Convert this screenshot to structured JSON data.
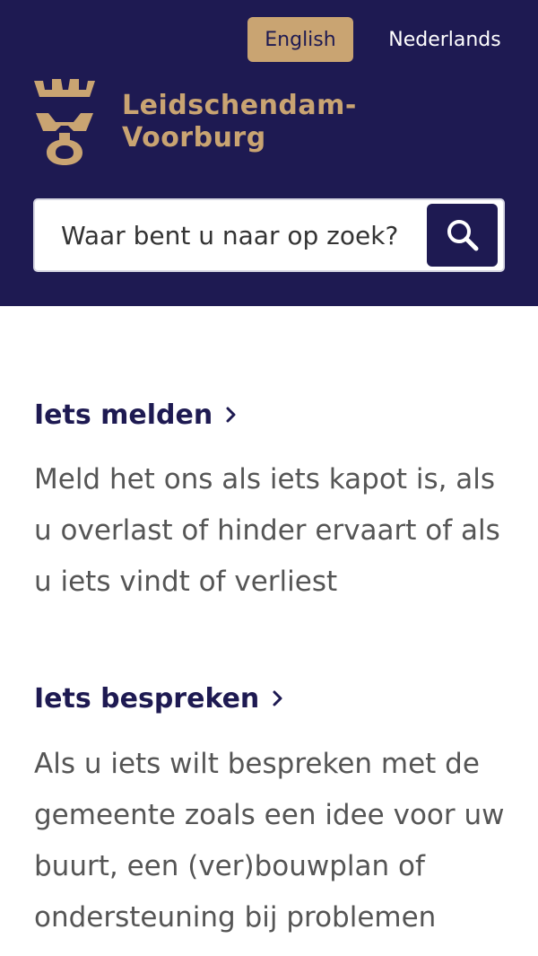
{
  "header": {
    "languages": {
      "english": "English",
      "dutch": "Nederlands"
    },
    "logo": {
      "line1": "Leidschendam-",
      "line2": "Voorburg",
      "icon": "crown-emblem-icon"
    },
    "search": {
      "placeholder": "Waar bent u naar op zoek?",
      "button_icon": "search-icon"
    },
    "colors": {
      "header_bg": "#1e1a52",
      "accent": "#c9a472"
    }
  },
  "main": {
    "sections": [
      {
        "title": "Iets melden",
        "description": "Meld het ons als iets kapot is, als u overlast of hinder ervaart of als u iets vindt of verliest"
      },
      {
        "title": "Iets bespreken",
        "description": "Als u iets wilt bespreken met de gemeente zoals een idee voor uw buurt, een (ver)bouwplan of ondersteuning bij problemen"
      }
    ]
  }
}
